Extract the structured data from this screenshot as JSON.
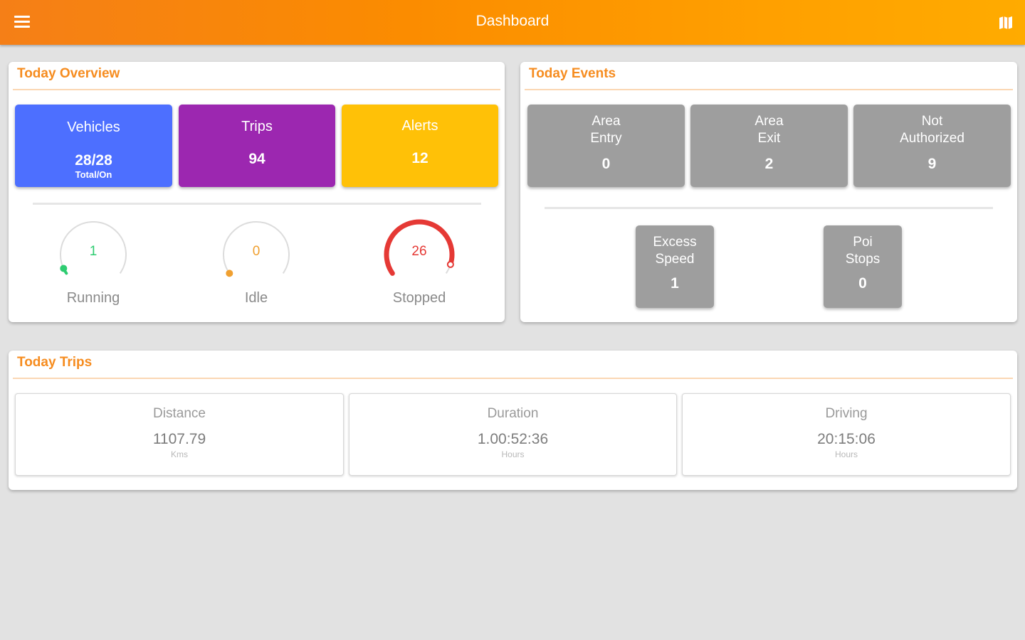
{
  "appbar": {
    "title": "Dashboard",
    "menu_icon": "menu-icon",
    "map_icon": "map-icon"
  },
  "overview": {
    "title": "Today Overview",
    "vehicles": {
      "label": "Vehicles",
      "value": "28/28",
      "sub": "Total/On",
      "color": "#4d6fff"
    },
    "trips": {
      "label": "Trips",
      "value": "94",
      "color": "#9c27b0"
    },
    "alerts": {
      "label": "Alerts",
      "value": "12",
      "color": "#ffc107"
    },
    "gauges": [
      {
        "label": "Running",
        "value": "1",
        "color": "#2ecc71",
        "fraction": 0.04
      },
      {
        "label": "Idle",
        "value": "0",
        "color": "#f0a030",
        "fraction": 0.0
      },
      {
        "label": "Stopped",
        "value": "26",
        "color": "#e53935",
        "fraction": 0.93
      }
    ]
  },
  "events": {
    "title": "Today Events",
    "tiles": [
      {
        "line1": "Area",
        "line2": "Entry",
        "value": "0"
      },
      {
        "line1": "Area",
        "line2": "Exit",
        "value": "2"
      },
      {
        "line1": "Not",
        "line2": "Authorized",
        "value": "9"
      },
      {
        "line1": "Excess",
        "line2": "Speed",
        "value": "1"
      },
      {
        "line1": "Poi",
        "line2": "Stops",
        "value": "0"
      }
    ]
  },
  "trips": {
    "title": "Today Trips",
    "boxes": [
      {
        "label": "Distance",
        "value": "1107.79",
        "unit": "Kms"
      },
      {
        "label": "Duration",
        "value": "1.00:52:36",
        "unit": "Hours"
      },
      {
        "label": "Driving",
        "value": "20:15:06",
        "unit": "Hours"
      }
    ]
  }
}
